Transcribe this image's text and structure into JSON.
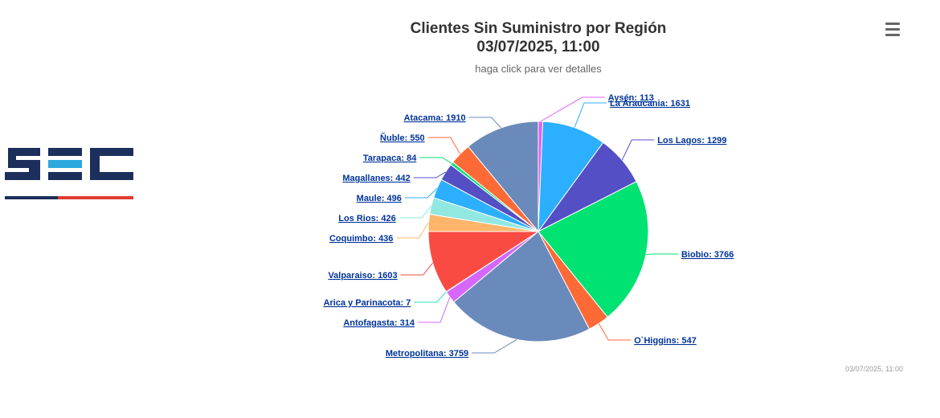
{
  "header": {
    "title_line1": "Clientes Sin Suministro por Región",
    "title_line2": "03/07/2025, 11:00",
    "subtitle": "haga click para ver detalles"
  },
  "logo": {
    "text": "SEC",
    "colors": [
      "#1c2f5c",
      "#2ba8dd",
      "#e03c31"
    ]
  },
  "menu": {
    "icon": "hamburger-menu-icon"
  },
  "footer": {
    "timestamp": "03/07/2025, 11:00"
  },
  "chart_data": {
    "type": "pie",
    "title": "Clientes Sin Suministro por Región 03/07/2025, 11:00",
    "subtitle": "haga click para ver detalles",
    "series": [
      {
        "points": [
          {
            "name": "Aysén",
            "value": 113,
            "color": "#e15eff"
          },
          {
            "name": "La Araucania",
            "value": 1631,
            "color": "#2caffe"
          },
          {
            "name": "Los Lagos",
            "value": 1299,
            "color": "#544fc5"
          },
          {
            "name": "Biobio",
            "value": 3766,
            "color": "#00e272"
          },
          {
            "name": "O`Higgins",
            "value": 547,
            "color": "#fe6a35"
          },
          {
            "name": "Metropolitana",
            "value": 3759,
            "color": "#6b8abc"
          },
          {
            "name": "Antofagasta",
            "value": 314,
            "color": "#d568fb"
          },
          {
            "name": "Arica y Parinacota",
            "value": 7,
            "color": "#2ee0ca"
          },
          {
            "name": "Valparaiso",
            "value": 1603,
            "color": "#fa4b42"
          },
          {
            "name": "Coquimbo",
            "value": 436,
            "color": "#feb56a"
          },
          {
            "name": "Los Rios",
            "value": 426,
            "color": "#91e8e1"
          },
          {
            "name": "Maule",
            "value": 496,
            "color": "#2caffe"
          },
          {
            "name": "Magallanes",
            "value": 442,
            "color": "#544fc5"
          },
          {
            "name": "Tarapaca",
            "value": 84,
            "color": "#00e272"
          },
          {
            "name": "Ñuble",
            "value": 550,
            "color": "#fe6a35"
          },
          {
            "name": "Atacama",
            "value": 1910,
            "color": "#6b8abc"
          }
        ]
      }
    ]
  }
}
